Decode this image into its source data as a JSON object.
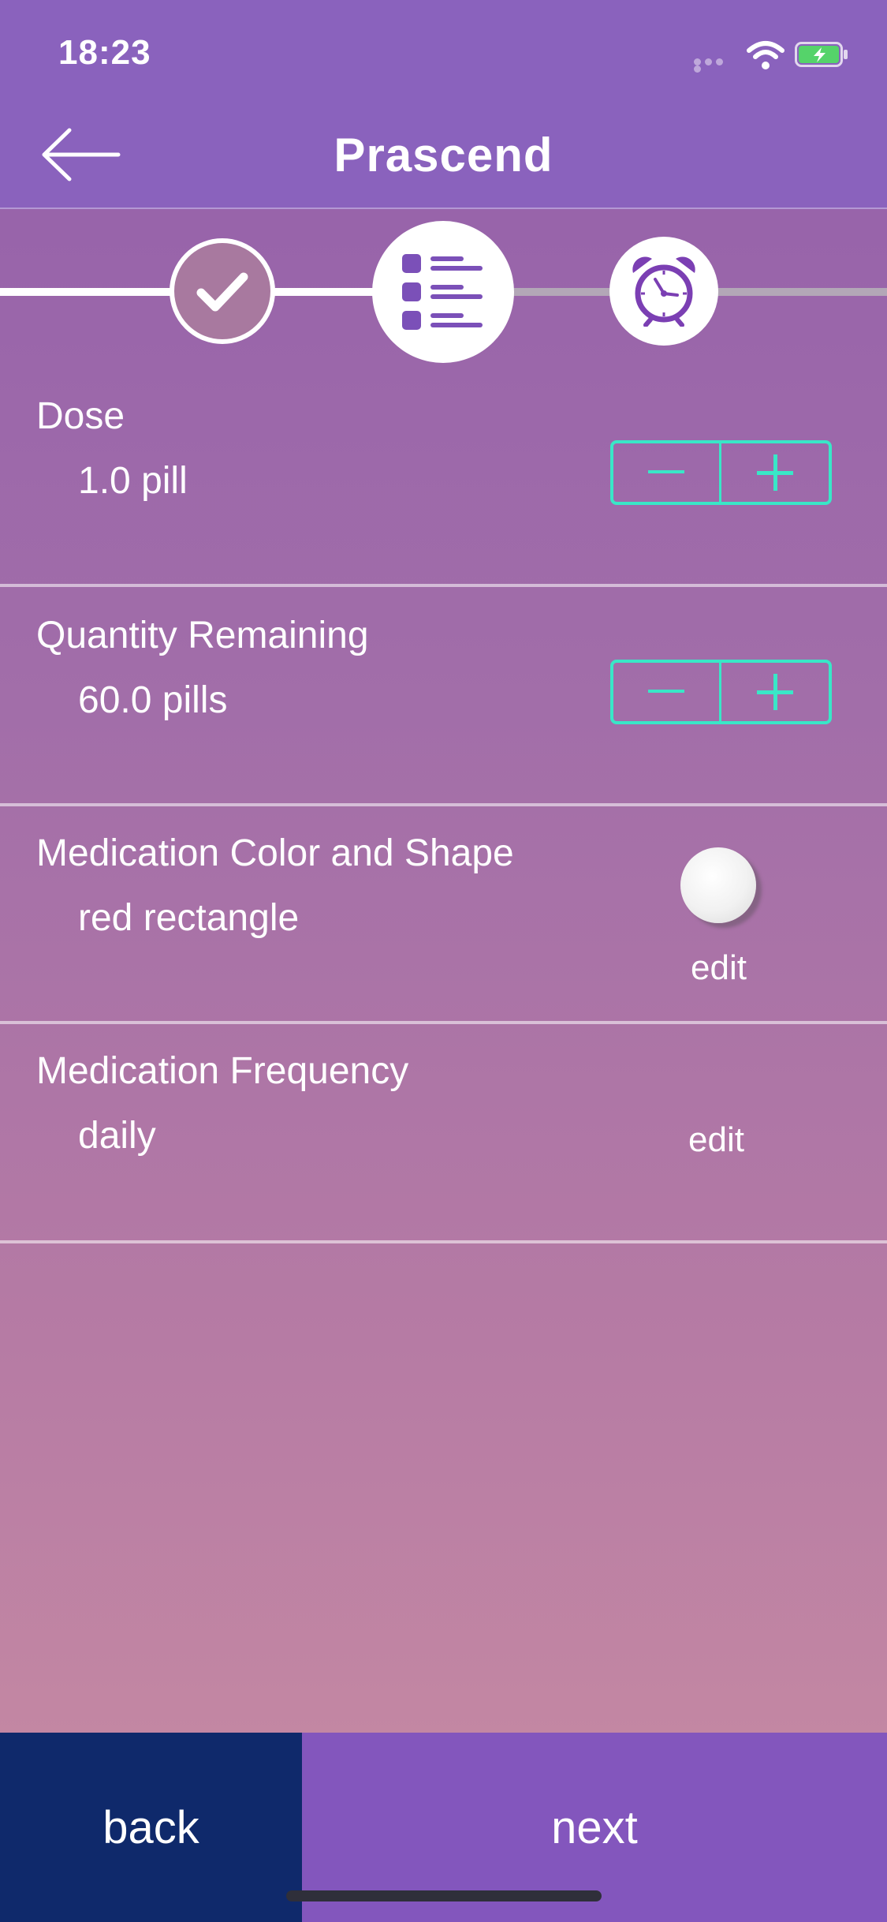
{
  "status_bar": {
    "time": "18:23",
    "icons": [
      "cellular-signal-icon",
      "wifi-icon",
      "battery-charging-icon"
    ]
  },
  "header": {
    "title": "Prascend",
    "back_icon": "arrow-left-icon"
  },
  "progress_steps": [
    {
      "icon": "checkmark-icon",
      "state": "completed"
    },
    {
      "icon": "list-icon",
      "state": "current"
    },
    {
      "icon": "alarm-clock-icon",
      "state": "upcoming"
    }
  ],
  "dose": {
    "label": "Dose",
    "value": "1.0 pill",
    "decrement_icon": "minus-icon",
    "increment_icon": "plus-icon"
  },
  "quantity": {
    "label": "Quantity Remaining",
    "value": "60.0 pills",
    "decrement_icon": "minus-icon",
    "increment_icon": "plus-icon"
  },
  "appearance": {
    "label": "Medication Color and Shape",
    "value": "red rectangle",
    "edit_label": "edit"
  },
  "frequency": {
    "label": "Medication Frequency",
    "value": "daily",
    "edit_label": "edit"
  },
  "footer": {
    "back_label": "back",
    "next_label": "next"
  },
  "colors": {
    "accent": "#39e7c7",
    "header_bg": "#8a62bd",
    "back_button_bg": "#0f296b",
    "next_button_bg": "#8356bd",
    "alarm_icon": "#7b3fb3"
  }
}
